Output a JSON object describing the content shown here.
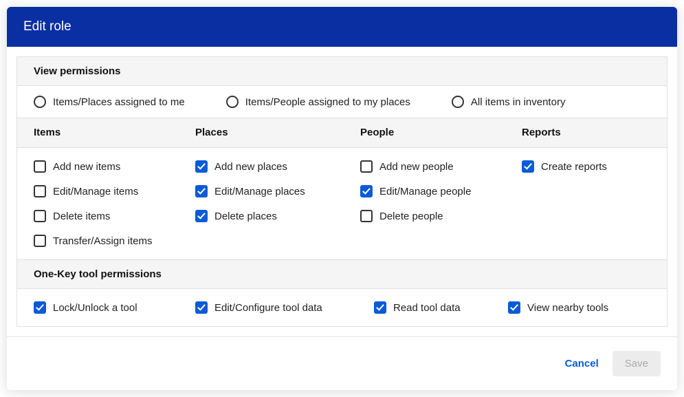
{
  "modal": {
    "title": "Edit role"
  },
  "view_permissions": {
    "header": "View permissions",
    "options": [
      {
        "label": "Items/Places assigned to me",
        "selected": false
      },
      {
        "label": "Items/People assigned to my places",
        "selected": false
      },
      {
        "label": "All items in inventory",
        "selected": false
      }
    ]
  },
  "columns": {
    "items": {
      "title": "Items"
    },
    "places": {
      "title": "Places"
    },
    "people": {
      "title": "People"
    },
    "reports": {
      "title": "Reports"
    }
  },
  "permissions": {
    "items": [
      {
        "label": "Add new items",
        "checked": false
      },
      {
        "label": "Edit/Manage items",
        "checked": false
      },
      {
        "label": "Delete items",
        "checked": false
      },
      {
        "label": "Transfer/Assign items",
        "checked": false
      }
    ],
    "places": [
      {
        "label": "Add new places",
        "checked": true
      },
      {
        "label": "Edit/Manage places",
        "checked": true
      },
      {
        "label": "Delete places",
        "checked": true
      }
    ],
    "people": [
      {
        "label": "Add new people",
        "checked": false
      },
      {
        "label": "Edit/Manage people",
        "checked": true
      },
      {
        "label": "Delete people",
        "checked": false
      }
    ],
    "reports": [
      {
        "label": "Create reports",
        "checked": true
      }
    ]
  },
  "tool_permissions": {
    "header": "One-Key tool permissions",
    "items": [
      {
        "label": "Lock/Unlock a tool",
        "checked": true
      },
      {
        "label": "Edit/Configure tool data",
        "checked": true
      },
      {
        "label": "Read tool data",
        "checked": true
      },
      {
        "label": "View nearby tools",
        "checked": true
      }
    ]
  },
  "footer": {
    "cancel": "Cancel",
    "save": "Save"
  }
}
